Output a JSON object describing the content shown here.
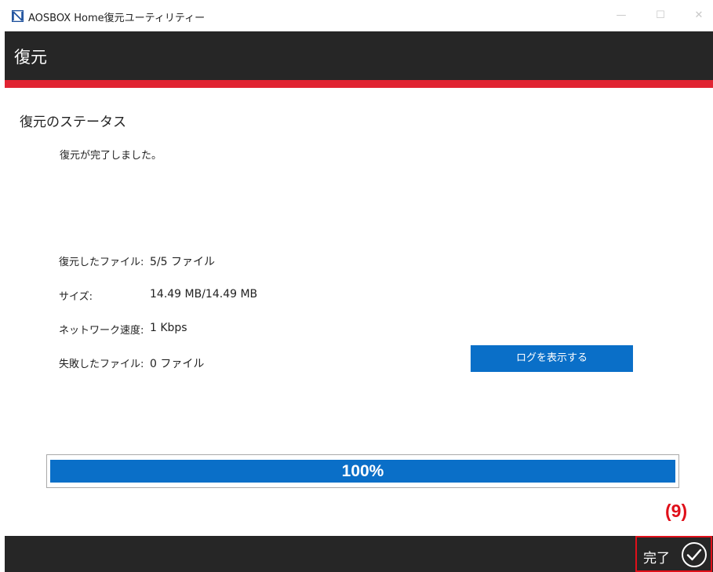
{
  "window": {
    "title": "AOSBOX Home復元ユーティリティー",
    "controls": {
      "minimize": "—",
      "maximize": "☐",
      "close": "✕"
    }
  },
  "header": {
    "title": "復元"
  },
  "status": {
    "section_title": "復元のステータス",
    "message": "復元が完了しました。",
    "rows": [
      {
        "label": "復元したファイル:",
        "value": "5/5 ファイル"
      },
      {
        "label": "サイズ:",
        "value": "14.49 MB/14.49 MB"
      },
      {
        "label": "ネットワーク速度:",
        "value": "1 Kbps"
      },
      {
        "label": "失敗したファイル:",
        "value": "0 ファイル"
      }
    ],
    "log_button": "ログを表示する"
  },
  "progress": {
    "percent": 100,
    "label": "100%"
  },
  "annotation": "(9)",
  "footer": {
    "done_label": "完了"
  },
  "colors": {
    "accent": "#0a6fc8",
    "header": "#262626",
    "brand_red": "#e02432",
    "annotation_red": "#e0101a"
  }
}
